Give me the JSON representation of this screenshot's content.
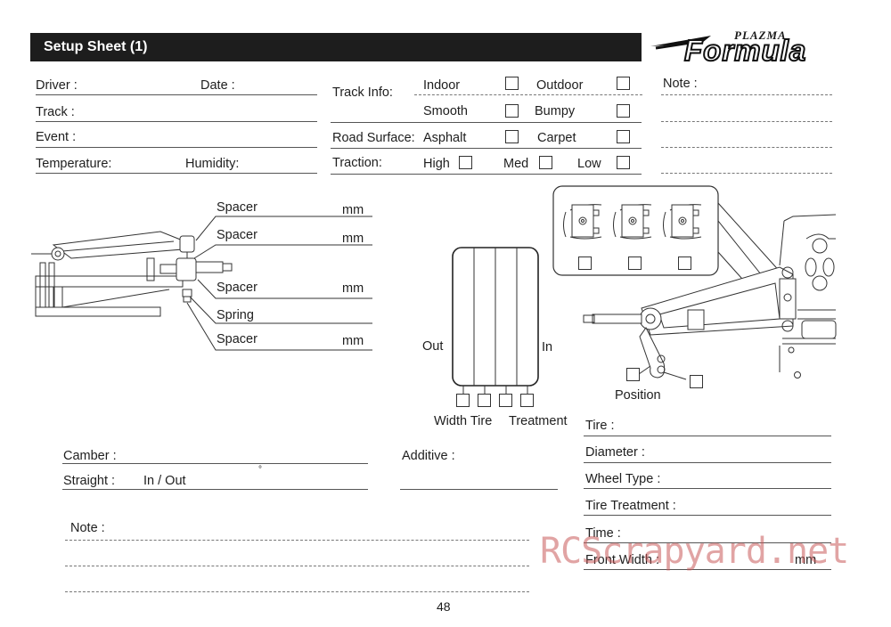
{
  "header": {
    "title": "Setup Sheet (1)",
    "logo_top": "PLAZMA",
    "logo_main": "Formula"
  },
  "general": {
    "driver_label": "Driver :",
    "date_label": "Date :",
    "track_label": "Track :",
    "event_label": "Event :",
    "temperature_label": "Temperature:",
    "humidity_label": "Humidity:"
  },
  "track_info": {
    "label": "Track Info:",
    "options": [
      "Indoor",
      "Outdoor",
      "Smooth",
      "Bumpy"
    ],
    "road_surface_label": "Road Surface:",
    "road_surface_options": [
      "Asphalt",
      "Carpet"
    ],
    "traction_label": "Traction:",
    "traction_options": [
      "High",
      "Med",
      "Low"
    ]
  },
  "note_top": {
    "label": "Note :"
  },
  "suspension": {
    "rows": [
      {
        "label": "Spacer",
        "unit": "mm"
      },
      {
        "label": "Spacer",
        "unit": "mm"
      },
      {
        "label": "Spacer",
        "unit": "mm"
      },
      {
        "label": "Spring",
        "unit": ""
      },
      {
        "label": "Spacer",
        "unit": "mm"
      }
    ]
  },
  "tire_diagram": {
    "out_label": "Out",
    "in_label": "In",
    "caption_left": "Width Tire",
    "caption_right": "Treatment"
  },
  "position_diagram": {
    "label": "Position"
  },
  "alignment": {
    "camber_label": "Camber :",
    "straight_label": "Straight :",
    "straight_value": "In / Out",
    "degree_symbol": "°",
    "additive_label": "Additive :"
  },
  "tire_info": {
    "tire_label": "Tire :",
    "diameter_label": "Diameter :",
    "wheel_type_label": "Wheel Type :",
    "tire_treatment_label": "Tire Treatment :",
    "time_label": "Time :",
    "front_width_label": "Front Width :",
    "front_width_unit": "mm"
  },
  "note_bottom": {
    "label": "Note :"
  },
  "footer": {
    "page_number": "48",
    "watermark": "RCScrapyard.net"
  }
}
